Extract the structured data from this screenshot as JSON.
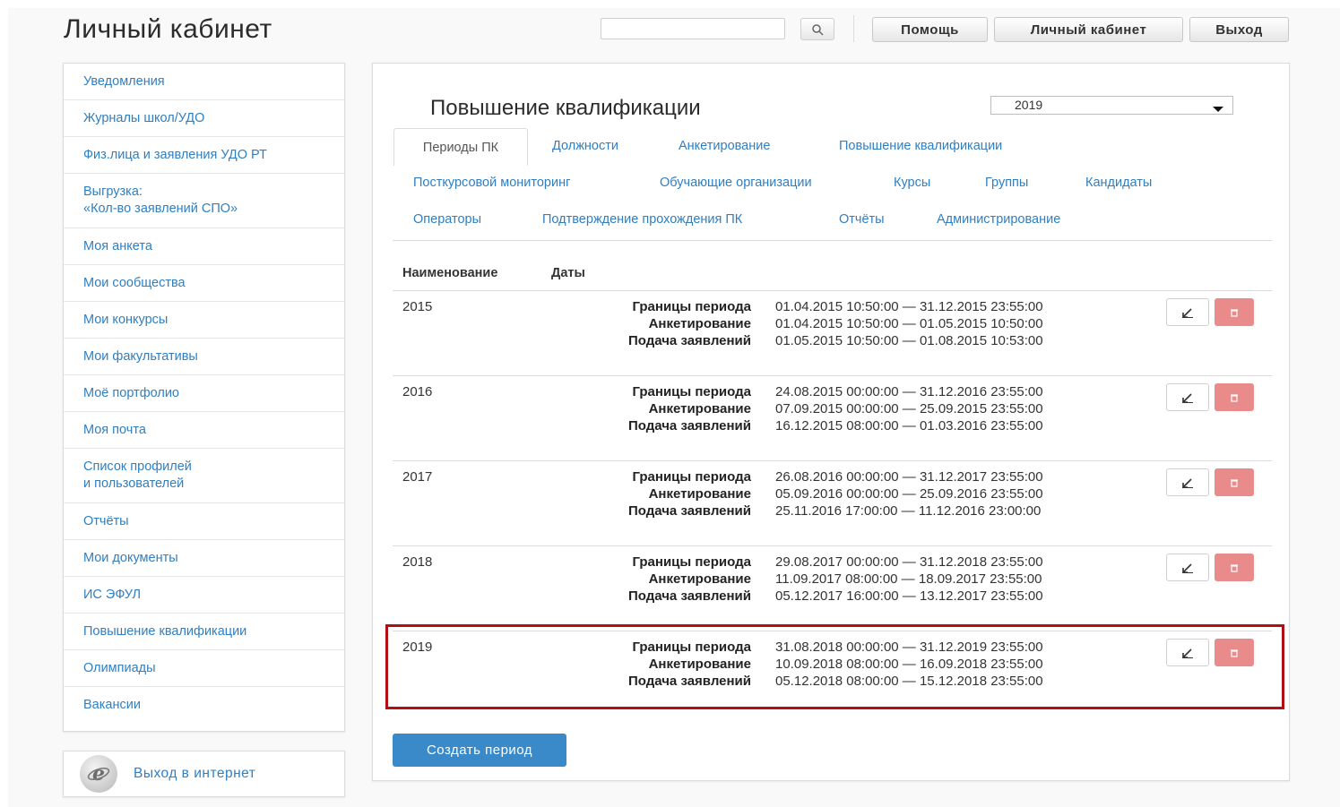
{
  "header": {
    "title": "Личный кабинет",
    "search_placeholder": "",
    "buttons": {
      "help": "Помощь",
      "account": "Личный кабинет",
      "logout": "Выход"
    }
  },
  "sidebar": {
    "items": [
      {
        "label": "Уведомления"
      },
      {
        "label": "Журналы школ/УДО"
      },
      {
        "label": "Физ.лица и заявления УДО РТ"
      },
      {
        "label": "Выгрузка:\n«Кол-во заявлений СПО»"
      },
      {
        "label": "Моя анкета"
      },
      {
        "label": "Мои сообщества"
      },
      {
        "label": "Мои конкурсы"
      },
      {
        "label": "Мои факультативы"
      },
      {
        "label": "Моё портфолио"
      },
      {
        "label": "Моя почта"
      },
      {
        "label": "Список профилей\nи пользователей"
      },
      {
        "label": "Отчёты"
      },
      {
        "label": "Мои документы"
      },
      {
        "label": "ИС ЭФУЛ"
      },
      {
        "label": "Повышение квалификации"
      },
      {
        "label": "Олимпиады"
      },
      {
        "label": "Вакансии"
      }
    ],
    "internet_label": "Выход в интернет"
  },
  "main": {
    "title": "Повышение квалификации",
    "year_selected": "2019",
    "tabs": [
      {
        "label": "Периоды ПК"
      },
      {
        "label": "Должности"
      },
      {
        "label": "Анкетирование"
      },
      {
        "label": "Повышение квалификации"
      },
      {
        "label": "Посткурсовой мониторинг"
      },
      {
        "label": "Обучающие организации"
      },
      {
        "label": "Курсы"
      },
      {
        "label": "Группы"
      },
      {
        "label": "Кандидаты"
      },
      {
        "label": "Операторы"
      },
      {
        "label": "Подтверждение прохождения ПК"
      },
      {
        "label": "Отчёты"
      },
      {
        "label": "Администрирование"
      }
    ],
    "table": {
      "headers": {
        "name": "Наименование",
        "dates": "Даты"
      },
      "date_labels": {
        "period": "Границы периода",
        "survey": "Анкетирование",
        "applications": "Подача заявлений"
      },
      "rows": [
        {
          "name": "2015",
          "period": "01.04.2015 10:50:00 — 31.12.2015 23:55:00",
          "survey": "01.04.2015 10:50:00 — 01.05.2015 10:50:00",
          "applications": "01.05.2015 10:50:00 — 01.08.2015 10:53:00"
        },
        {
          "name": "2016",
          "period": "24.08.2015 00:00:00 — 31.12.2016 23:55:00",
          "survey": "07.09.2015 00:00:00 — 25.09.2015 23:55:00",
          "applications": "16.12.2015 08:00:00 — 01.03.2016 23:55:00"
        },
        {
          "name": "2017",
          "period": "26.08.2016 00:00:00 — 31.12.2017 23:55:00",
          "survey": "05.09.2016 00:00:00 — 25.09.2016 23:55:00",
          "applications": "25.11.2016 17:00:00 — 11.12.2016 23:00:00"
        },
        {
          "name": "2018",
          "period": "29.08.2017 00:00:00 — 31.12.2018 23:55:00",
          "survey": "11.09.2017 08:00:00 — 18.09.2017 23:55:00",
          "applications": "05.12.2017 16:00:00 — 13.12.2017 23:55:00"
        },
        {
          "name": "2019",
          "period": "31.08.2018 00:00:00 — 31.12.2019 23:55:00",
          "survey": "10.09.2018 08:00:00 — 16.09.2018 23:55:00",
          "applications": "05.12.2018 08:00:00 — 15.12.2018 23:55:00"
        }
      ]
    },
    "create_button": "Создать период"
  },
  "colors": {
    "link": "#2f7fc1",
    "primary_button": "#3a89c9",
    "delete_button": "#e98b8b",
    "highlight": "#b20f14"
  }
}
